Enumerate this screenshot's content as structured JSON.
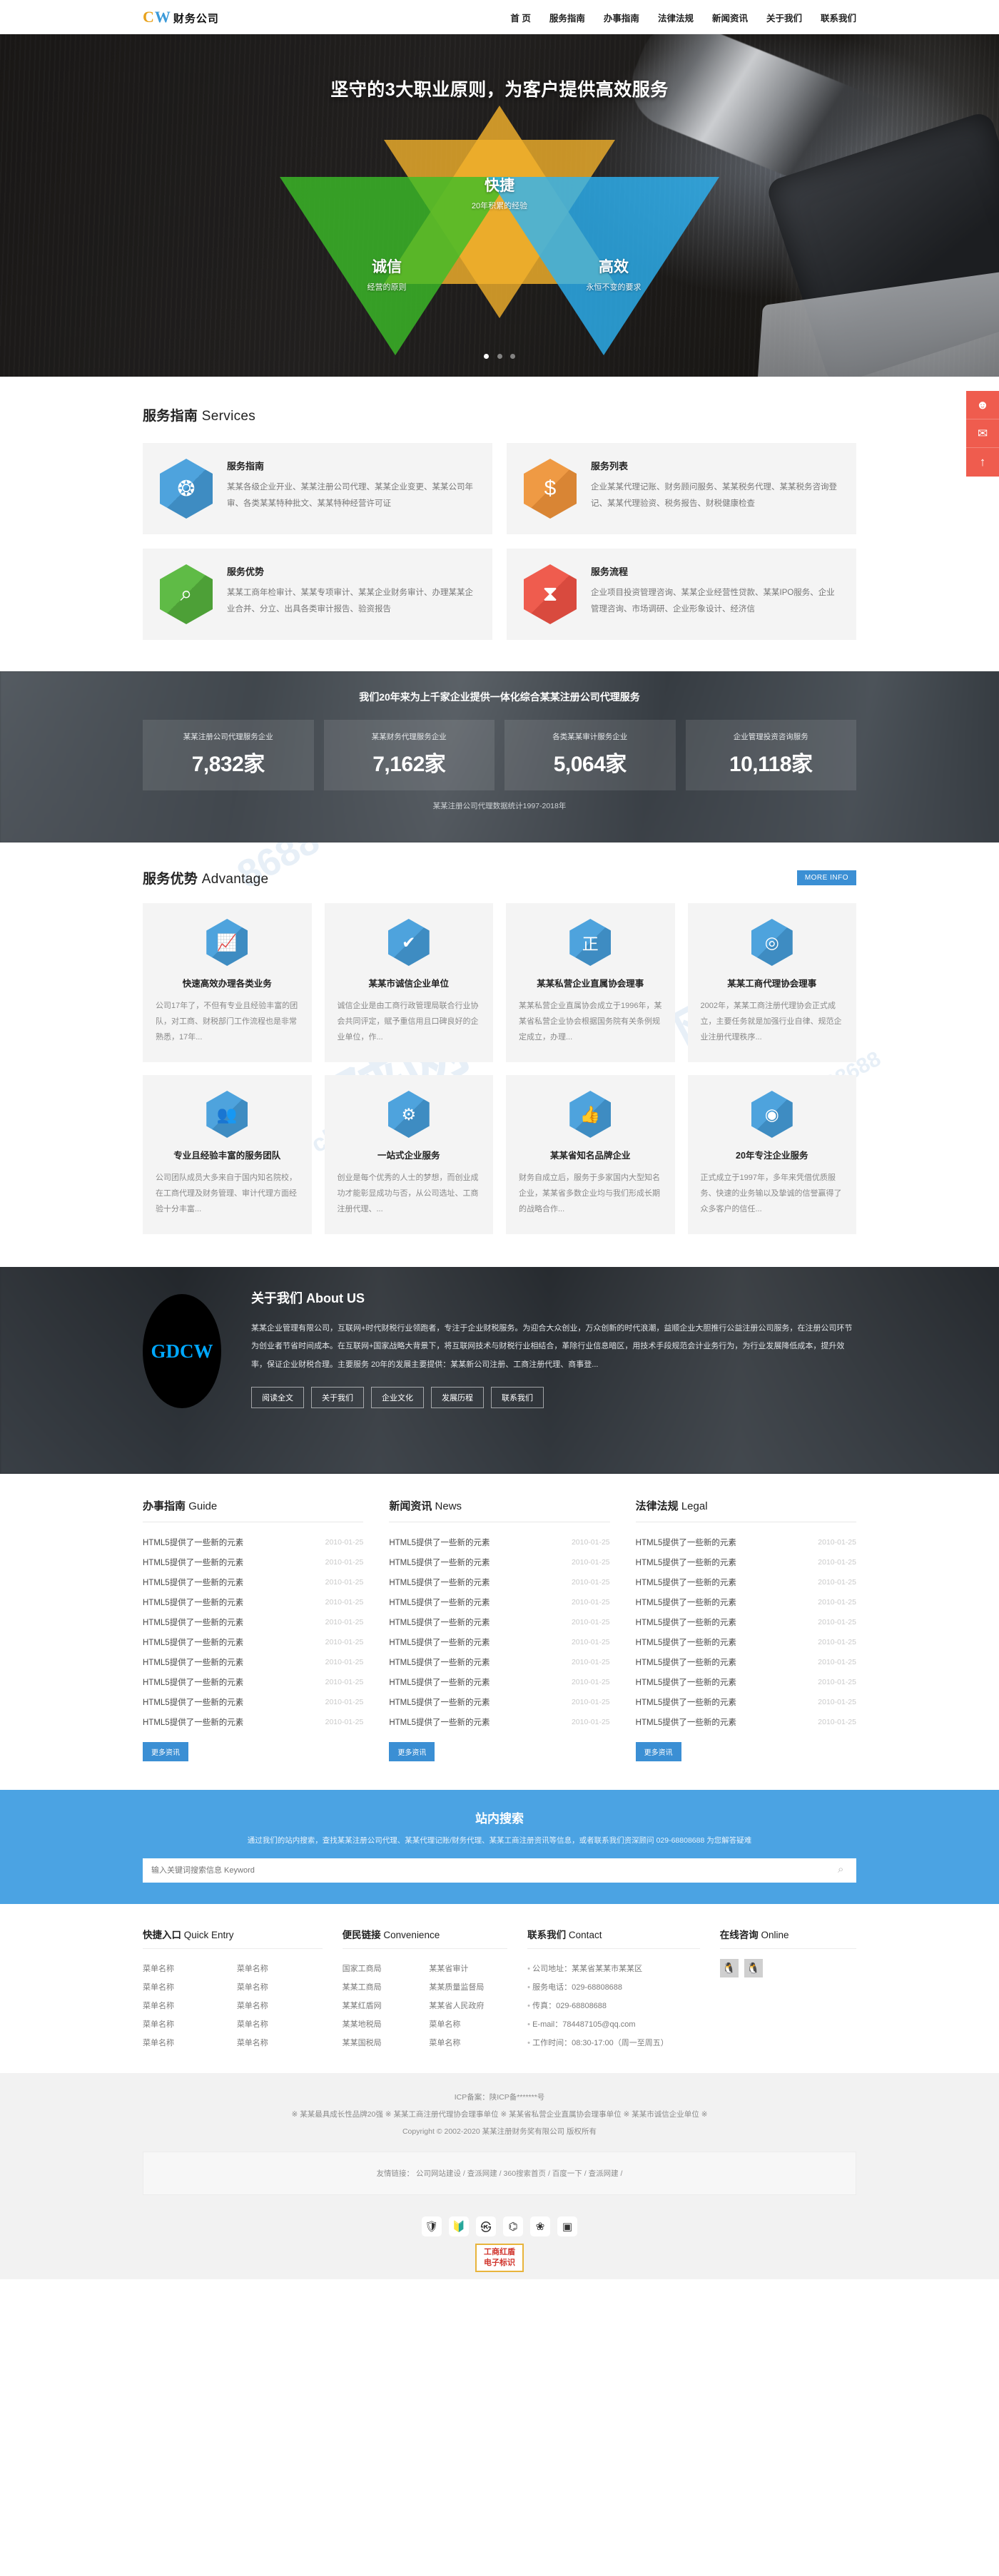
{
  "header": {
    "logo": {
      "c": "C",
      "w": "W",
      "cn": "财务公司"
    },
    "nav": [
      {
        "label": "首 页"
      },
      {
        "label": "服务指南"
      },
      {
        "label": "办事指南"
      },
      {
        "label": "法律法规"
      },
      {
        "label": "新闻资讯"
      },
      {
        "label": "关于我们"
      },
      {
        "label": "联系我们"
      }
    ]
  },
  "hero": {
    "title": "坚守的3大职业原则，为客户提供高效服务",
    "points": [
      {
        "big": "快捷",
        "small": "20年积累的经验"
      },
      {
        "big": "诚信",
        "small": "经营的原则"
      },
      {
        "big": "高效",
        "small": "永恒不变的要求"
      }
    ],
    "slides": 3,
    "active_slide": 1
  },
  "side_buttons": [
    {
      "icon": "qq-icon",
      "glyph": "☻"
    },
    {
      "icon": "chat-icon",
      "glyph": "✉"
    },
    {
      "icon": "back-to-top-icon",
      "glyph": "↑"
    }
  ],
  "services": {
    "title_cn": "服务指南",
    "title_en": "Services",
    "cards": [
      {
        "title": "服务指南",
        "icon": "ribbon-award-icon",
        "glyph": "❂",
        "color": "blue",
        "desc": "某某各级企业开业、某某注册公司代理、某某企业变更、某某公司年审、各类某某特种批文、某某特种经营许可证"
      },
      {
        "title": "服务列表",
        "icon": "money-bag-icon",
        "glyph": "$",
        "color": "orange",
        "desc": "企业某某代理记账、财务顾问服务、某某税务代理、某某税务咨询登记、某某代理验资、税务报告、财税健康检查"
      },
      {
        "title": "服务优势",
        "icon": "chart-magnifier-icon",
        "glyph": "⌕",
        "color": "green",
        "desc": "某某工商年检审计、某某专项审计、某某企业财务审计、办理某某企业合并、分立、出具各类审计报告、验资报告"
      },
      {
        "title": "服务流程",
        "icon": "hourglass-icon",
        "glyph": "⧗",
        "color": "red",
        "desc": "企业项目投资管理咨询、某某企业经营性贷款、某某IPO服务、企业管理咨询、市场调研、企业形象设计、经济信"
      }
    ]
  },
  "counter": {
    "heading": "我们20年来为上千家企业提供一体化综合某某注册公司代理服务",
    "items": [
      {
        "label": "某某注册公司代理服务企业",
        "value": "7,832家"
      },
      {
        "label": "某某财务代理服务企业",
        "value": "7,162家"
      },
      {
        "label": "各类某某审计服务企业",
        "value": "5,064家"
      },
      {
        "label": "企业管理投资咨询服务",
        "value": "10,118家"
      }
    ],
    "footnote": "某某注册公司代理数据统计1997-2018年"
  },
  "advantage": {
    "title_cn": "服务优势",
    "title_en": "Advantage",
    "more_label": "MORE INFO",
    "cards": [
      {
        "icon": "growth-chart-icon",
        "glyph": "📈",
        "title": "快速高效办理各类业务",
        "desc": "公司17年了，不但有专业且经验丰富的团队，对工商、财税部门工作流程也是非常熟悉，17年..."
      },
      {
        "icon": "shield-check-icon",
        "glyph": "✔",
        "title": "某某市诚信企业单位",
        "desc": "诚信企业是由工商行政管理局联合行业协会共同评定，赋予重信用且口碑良好的企业单位，作..."
      },
      {
        "icon": "zheng-character-icon",
        "glyph": "正",
        "title": "某某私营企业直属协会理事",
        "desc": "某某私营企业直属协会成立于1996年，某某省私营企业协会根据国务院有关条例规定成立，办理..."
      },
      {
        "icon": "association-emblem-icon",
        "glyph": "◎",
        "title": "某某工商代理协会理事",
        "desc": "2002年，某某工商注册代理协会正式成立，主要任务就是加强行业自律、规范企业注册代理秩序..."
      },
      {
        "icon": "team-people-icon",
        "glyph": "👥",
        "title": "专业且经验丰富的服务团队",
        "desc": "公司团队成员大多来自于国内知名院校，在工商代理及财务管理、审计代理方面经验十分丰富..."
      },
      {
        "icon": "gears-icon",
        "glyph": "⚙",
        "title": "一站式企业服务",
        "desc": "创业是每个优秀的人士的梦想，而创业成功才能彰显成功与否，从公司选址、工商注册代理、..."
      },
      {
        "icon": "thumbs-up-icon",
        "glyph": "👍",
        "title": "某某省知名品牌企业",
        "desc": "财务自成立后，服务于多家国内大型知名企业，某某省多数企业均与我们形成长期的战略合作..."
      },
      {
        "icon": "target-icon",
        "glyph": "◉",
        "title": "20年专注企业服务",
        "desc": "正式成立于1997年，多年来凭借优质服务、快速的业务输以及挚诚的信誉赢得了众多客户的信任..."
      }
    ]
  },
  "about": {
    "logo_text": "GDCW",
    "title_cn": "关于我们",
    "title_en": "About US",
    "paragraph": "某某企业管理有限公司，互联网+时代财税行业领跑者，专注于企业财税服务。为迎合大众创业，万众创新的时代浪潮，益顺企业大胆推行公益注册公司服务，在注册公司环节为创业者节省时间成本。在互联网+国家战略大背景下，将互联网技术与财税行业相结合，革除行业信息暗区，用技术手段规范会计业务行为，为行业发展降低成本，提升效率，保证企业财税合理。主要服务 20年的发展主要提供：某某新公司注册、工商注册代理、商事登...",
    "buttons": [
      {
        "label": "阅读全文"
      },
      {
        "label": "关于我们"
      },
      {
        "label": "企业文化"
      },
      {
        "label": "发展历程"
      },
      {
        "label": "联系我们"
      }
    ]
  },
  "news": {
    "columns": [
      {
        "title_cn": "办事指南",
        "title_en": "Guide",
        "more_label": "更多资讯",
        "items": [
          {
            "title": "HTML5提供了一些新的元素",
            "date": "2010-01-25"
          },
          {
            "title": "HTML5提供了一些新的元素",
            "date": "2010-01-25"
          },
          {
            "title": "HTML5提供了一些新的元素",
            "date": "2010-01-25"
          },
          {
            "title": "HTML5提供了一些新的元素",
            "date": "2010-01-25"
          },
          {
            "title": "HTML5提供了一些新的元素",
            "date": "2010-01-25"
          },
          {
            "title": "HTML5提供了一些新的元素",
            "date": "2010-01-25"
          },
          {
            "title": "HTML5提供了一些新的元素",
            "date": "2010-01-25"
          },
          {
            "title": "HTML5提供了一些新的元素",
            "date": "2010-01-25"
          },
          {
            "title": "HTML5提供了一些新的元素",
            "date": "2010-01-25"
          },
          {
            "title": "HTML5提供了一些新的元素",
            "date": "2010-01-25"
          }
        ]
      },
      {
        "title_cn": "新闻资讯",
        "title_en": "News",
        "more_label": "更多资讯",
        "items": [
          {
            "title": "HTML5提供了一些新的元素",
            "date": "2010-01-25"
          },
          {
            "title": "HTML5提供了一些新的元素",
            "date": "2010-01-25"
          },
          {
            "title": "HTML5提供了一些新的元素",
            "date": "2010-01-25"
          },
          {
            "title": "HTML5提供了一些新的元素",
            "date": "2010-01-25"
          },
          {
            "title": "HTML5提供了一些新的元素",
            "date": "2010-01-25"
          },
          {
            "title": "HTML5提供了一些新的元素",
            "date": "2010-01-25"
          },
          {
            "title": "HTML5提供了一些新的元素",
            "date": "2010-01-25"
          },
          {
            "title": "HTML5提供了一些新的元素",
            "date": "2010-01-25"
          },
          {
            "title": "HTML5提供了一些新的元素",
            "date": "2010-01-25"
          },
          {
            "title": "HTML5提供了一些新的元素",
            "date": "2010-01-25"
          }
        ]
      },
      {
        "title_cn": "法律法规",
        "title_en": "Legal",
        "more_label": "更多资讯",
        "items": [
          {
            "title": "HTML5提供了一些新的元素",
            "date": "2010-01-25"
          },
          {
            "title": "HTML5提供了一些新的元素",
            "date": "2010-01-25"
          },
          {
            "title": "HTML5提供了一些新的元素",
            "date": "2010-01-25"
          },
          {
            "title": "HTML5提供了一些新的元素",
            "date": "2010-01-25"
          },
          {
            "title": "HTML5提供了一些新的元素",
            "date": "2010-01-25"
          },
          {
            "title": "HTML5提供了一些新的元素",
            "date": "2010-01-25"
          },
          {
            "title": "HTML5提供了一些新的元素",
            "date": "2010-01-25"
          },
          {
            "title": "HTML5提供了一些新的元素",
            "date": "2010-01-25"
          },
          {
            "title": "HTML5提供了一些新的元素",
            "date": "2010-01-25"
          },
          {
            "title": "HTML5提供了一些新的元素",
            "date": "2010-01-25"
          }
        ]
      }
    ]
  },
  "search": {
    "title": "站内搜索",
    "subtitle": "通过我们的站内搜索，查找某某注册公司代理、某某代理记账/财务代理、某某工商注册资讯等信息，或者联系我们资深顾问 029-68808688 为您解答疑难",
    "placeholder": "输入关键词搜索信息 Keyword",
    "value": ""
  },
  "footer": {
    "quick_entry": {
      "title_cn": "快捷入口",
      "title_en": "Quick Entry",
      "links": [
        "菜单名称",
        "菜单名称",
        "菜单名称",
        "菜单名称",
        "菜单名称",
        "菜单名称",
        "菜单名称",
        "菜单名称",
        "菜单名称",
        "菜单名称"
      ]
    },
    "convenience": {
      "title_cn": "便民链接",
      "title_en": "Convenience",
      "links": [
        "国家工商局",
        "某某省审计",
        "某某工商局",
        "某某质量监督局",
        "某某红盾网",
        "某某省人民政府",
        "某某地税局",
        "菜单名称",
        "某某国税局",
        "菜单名称"
      ]
    },
    "contact": {
      "title_cn": "联系我们",
      "title_en": "Contact",
      "items": [
        "公司地址：某某省某某市某某区",
        "服务电话：029-68808688",
        "传真：029-68808688",
        "E-mail：784487105@qq.com",
        "工作时间：08:30-17:00（周一至周五）"
      ]
    },
    "online": {
      "title_cn": "在线咨询",
      "title_en": "Online",
      "qq_icons": [
        {
          "icon": "qq-penguin-icon",
          "glyph": "🐧"
        },
        {
          "icon": "qq-penguin-icon",
          "glyph": "🐧"
        }
      ]
    }
  },
  "copyright": {
    "icp": "ICP备案：陕ICP备*******号",
    "honors": "※ 某某最具成长性品牌20强 ※ 某某工商注册代理协会理事单位 ※ 某某省私营企业直属协会理事单位 ※ 某某市诚信企业单位 ※",
    "line": "Copyright © 2002-2020 某某注册财务奖有限公司 版权所有",
    "friend_label": "友情链接：",
    "friend_links": [
      "公司网站建设",
      "查派网建",
      "360搜索首页",
      "百度一下",
      "查派网建"
    ],
    "cert_badges": [
      {
        "icon": "police-badge-icon",
        "glyph": "🛡"
      },
      {
        "icon": "security-shield-icon",
        "glyph": "🔰"
      },
      {
        "icon": "credit-icon",
        "glyph": "㉿"
      },
      {
        "icon": "redflag-icon",
        "glyph": "⌬"
      },
      {
        "icon": "gov-emblem-icon",
        "glyph": "❀"
      },
      {
        "icon": "net-police-icon",
        "glyph": "▣"
      }
    ],
    "redshield": {
      "line1": "工商红盾",
      "line2": "电子标识"
    }
  }
}
